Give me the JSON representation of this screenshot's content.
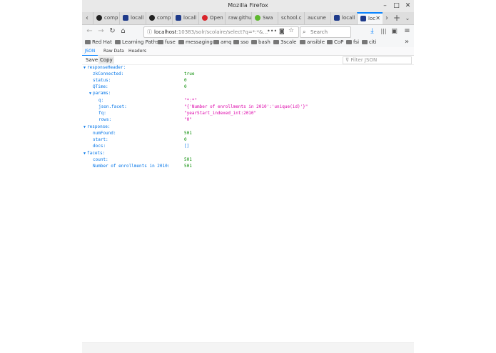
{
  "window": {
    "title": "Mozilla Firefox"
  },
  "tabs": [
    {
      "label": "comp",
      "icon": "github-icon",
      "color": "#222222"
    },
    {
      "label": "locall",
      "icon": "solr-icon",
      "color": "#1e3a8a"
    },
    {
      "label": "comp",
      "icon": "github-icon",
      "color": "#222222"
    },
    {
      "label": "locall",
      "icon": "solr-icon",
      "color": "#1e3a8a"
    },
    {
      "label": "Open",
      "icon": "openshift-icon",
      "color": "#d9242b"
    },
    {
      "label": "raw.githu",
      "icon": "none",
      "color": ""
    },
    {
      "label": "Swa",
      "icon": "swagger-icon",
      "color": "#5eb82e"
    },
    {
      "label": "school.c",
      "icon": "none",
      "color": ""
    },
    {
      "label": "aucune",
      "icon": "none",
      "color": ""
    },
    {
      "label": "locall",
      "icon": "solr-icon",
      "color": "#1e3a8a"
    },
    {
      "label": "loc",
      "icon": "solr-icon",
      "color": "#1e3a8a",
      "active": true
    }
  ],
  "navbar": {
    "url_host": "localhost",
    "url_rest": ":10383/solr/scolaire/select?q=*:*&...",
    "search_placeholder": "Search"
  },
  "bookmarks": [
    "Red Hat",
    "Learning Paths",
    "fuse",
    "messaging",
    "amq",
    "sso",
    "bash",
    "3scale",
    "ansible",
    "CoP",
    "fsi",
    "citi"
  ],
  "viewer": {
    "tabs": [
      "JSON",
      "Raw Data",
      "Headers"
    ],
    "save_label": "Save",
    "copy_label": "Copy",
    "filter_placeholder": "Filter JSON"
  },
  "json": {
    "responseHeader": "responseHeader:",
    "zkConnected_k": "zkConnected:",
    "zkConnected_v": "true",
    "status_k": "status:",
    "status_v": "0",
    "QTime_k": "QTime:",
    "QTime_v": "0",
    "params": "params:",
    "q_k": "q:",
    "q_v": "\"*:*\"",
    "jsonfacet_k": "json.facet:",
    "jsonfacet_v": "\"{'Number of enrollments in 2010':'unique(id)'}\"",
    "fq_k": "fq:",
    "fq_v": "\"yearStart_indexed_int:2010\"",
    "rows_k": "rows:",
    "rows_v": "\"0\"",
    "response": "response:",
    "numFound_k": "numFound:",
    "numFound_v": "501",
    "start_k": "start:",
    "start_v": "0",
    "docs_k": "docs:",
    "docs_v": "[]",
    "facets": "facets:",
    "count_k": "count:",
    "count_v": "501",
    "noe_k": "Number of enrollments in 2010:",
    "noe_v": "501"
  },
  "colors": {
    "accent": "#0a84ff",
    "key": "#0074e8",
    "number": "#058b00",
    "string": "#dd00a9"
  }
}
